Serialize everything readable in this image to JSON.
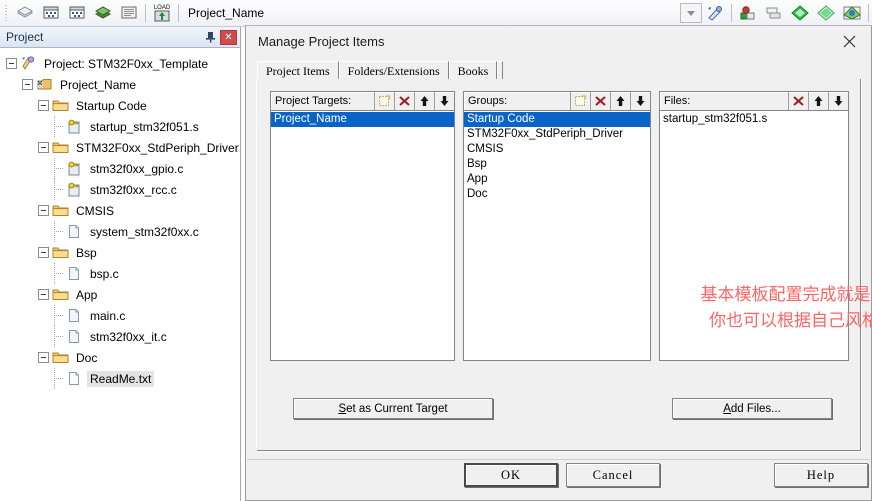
{
  "toolbar": {
    "icons": [
      {
        "name": "build-target-icon"
      },
      {
        "name": "batch-build-icon"
      },
      {
        "name": "rebuild-all-icon"
      },
      {
        "name": "build-icon"
      },
      {
        "name": "stop-build-icon"
      },
      {
        "name": "download-to-flash-icon",
        "label": "LOAD"
      }
    ],
    "project_name": "Project_Name",
    "dropdown": {
      "name": "target-combo-arrow"
    },
    "right_icons": [
      {
        "name": "target-options-icon"
      },
      {
        "name": "manage-components-icon"
      },
      {
        "name": "multi-project-icon"
      },
      {
        "name": "pack-installer-icon"
      },
      {
        "name": "manage-run-time-env-icon"
      },
      {
        "name": "software-packs-icon"
      }
    ]
  },
  "project_panel": {
    "title": "Project",
    "pin_icon": "pin-icon",
    "close_icon": "close-icon",
    "tree": [
      {
        "label": "Project: STM32F0xx_Template",
        "depth": 0,
        "icon": "project-icon",
        "expander": true
      },
      {
        "label": "Project_Name",
        "depth": 1,
        "icon": "target-icon",
        "expander": true
      },
      {
        "label": "Startup Code",
        "depth": 2,
        "icon": "folder-icon",
        "expander": true
      },
      {
        "label": "startup_stm32f051.s",
        "depth": 3,
        "icon": "asm-file-icon",
        "expander": false
      },
      {
        "label": "STM32F0xx_StdPeriph_Driver",
        "depth": 2,
        "icon": "folder-icon",
        "expander": true
      },
      {
        "label": "stm32f0xx_gpio.c",
        "depth": 3,
        "icon": "c-file-icon",
        "expander": false
      },
      {
        "label": "stm32f0xx_rcc.c",
        "depth": 3,
        "icon": "c-file-icon",
        "expander": false
      },
      {
        "label": "CMSIS",
        "depth": 2,
        "icon": "folder-icon",
        "expander": true
      },
      {
        "label": "system_stm32f0xx.c",
        "depth": 3,
        "icon": "plain-file-icon",
        "expander": false
      },
      {
        "label": "Bsp",
        "depth": 2,
        "icon": "folder-icon",
        "expander": true
      },
      {
        "label": "bsp.c",
        "depth": 3,
        "icon": "plain-file-icon",
        "expander": false
      },
      {
        "label": "App",
        "depth": 2,
        "icon": "folder-icon",
        "expander": true
      },
      {
        "label": "main.c",
        "depth": 3,
        "icon": "plain-file-icon",
        "expander": false
      },
      {
        "label": "stm32f0xx_it.c",
        "depth": 3,
        "icon": "plain-file-icon",
        "expander": false
      },
      {
        "label": "Doc",
        "depth": 2,
        "icon": "folder-icon",
        "expander": true
      },
      {
        "label": "ReadMe.txt",
        "depth": 3,
        "icon": "txt-file-icon",
        "expander": false,
        "selected": true
      }
    ]
  },
  "dialog": {
    "title": "Manage Project Items",
    "close_icon": "close-icon",
    "tabs": [
      {
        "label": "Project Items",
        "active": true
      },
      {
        "label": "Folders/Extensions",
        "active": false
      },
      {
        "label": "Books",
        "active": false
      }
    ],
    "columns": [
      {
        "name": "project-targets",
        "header": "Project Targets:",
        "buttons": [
          "new-item-icon",
          "delete-icon",
          "move-up-icon",
          "move-down-icon"
        ],
        "items": [
          {
            "label": "Project_Name",
            "selected": true
          }
        ]
      },
      {
        "name": "groups",
        "header": "Groups:",
        "buttons": [
          "new-item-icon",
          "delete-icon",
          "move-up-icon",
          "move-down-icon"
        ],
        "items": [
          {
            "label": "Startup Code",
            "selected": true
          },
          {
            "label": "STM32F0xx_StdPeriph_Driver",
            "selected": false
          },
          {
            "label": "CMSIS",
            "selected": false
          },
          {
            "label": "Bsp",
            "selected": false
          },
          {
            "label": "App",
            "selected": false
          },
          {
            "label": "Doc",
            "selected": false
          }
        ]
      },
      {
        "name": "files",
        "header": "Files:",
        "buttons": [
          "delete-icon",
          "move-up-icon",
          "move-down-icon"
        ],
        "items": [
          {
            "label": "startup_stm32f051.s",
            "selected": false
          }
        ]
      }
    ],
    "set_current_target_button": {
      "prefix": "",
      "accel": "S",
      "rest": "et as Current Target"
    },
    "add_files_button": {
      "prefix": "",
      "accel": "A",
      "rest": "dd Files..."
    },
    "footer_buttons": [
      {
        "label": "OK",
        "name": "ok-button",
        "default": true
      },
      {
        "label": "Cancel",
        "name": "cancel-button",
        "default": false
      },
      {
        "label": "Help",
        "name": "help-button",
        "default": false
      }
    ]
  },
  "annotation": {
    "line1": "基本模板配置完成就是这样子",
    "line2": "你也可以根据自己风格修改",
    "color": "#ff6464"
  }
}
